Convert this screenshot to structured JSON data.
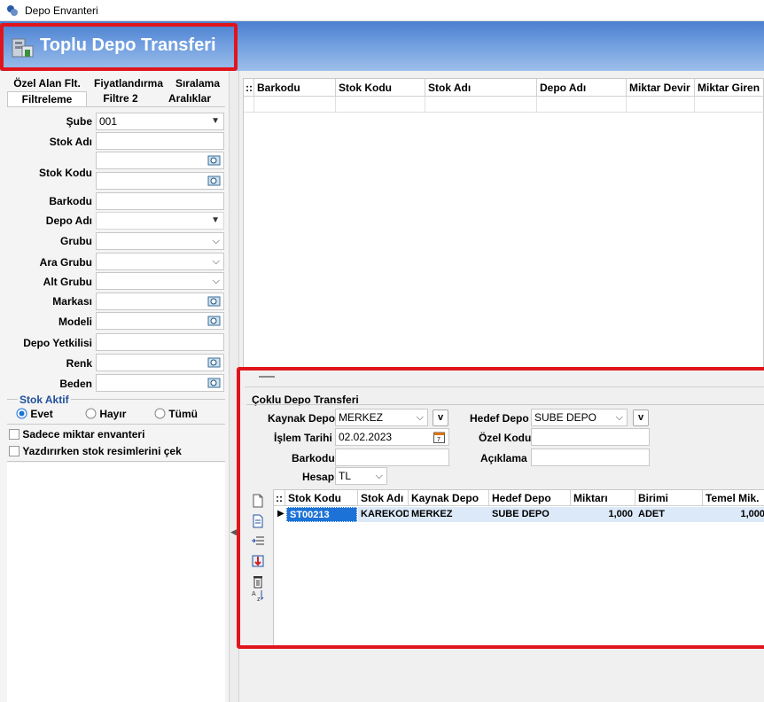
{
  "window": {
    "title": "Depo Envanteri"
  },
  "header": {
    "title": "Toplu Depo Transferi"
  },
  "tabs_row1": [
    "Özel Alan Flt.",
    "Fiyatlandırma",
    "Sıralama"
  ],
  "tabs_row2": [
    "Filtreleme",
    "Filtre 2",
    "Aralıklar"
  ],
  "filters": {
    "sube": {
      "label": "Şube",
      "value": "001"
    },
    "stok_adi": {
      "label": "Stok Adı"
    },
    "stok_kodu": {
      "label": "Stok Kodu"
    },
    "barkodu": {
      "label": "Barkodu"
    },
    "depo_adi": {
      "label": "Depo Adı"
    },
    "grubu": {
      "label": "Grubu"
    },
    "ara_grubu": {
      "label": "Ara Grubu"
    },
    "alt_grubu": {
      "label": "Alt Grubu"
    },
    "markasi": {
      "label": "Markası"
    },
    "modeli": {
      "label": "Modeli"
    },
    "depo_yetkilisi": {
      "label": "Depo Yetkilisi"
    },
    "renk": {
      "label": "Renk"
    },
    "beden": {
      "label": "Beden"
    }
  },
  "stok_aktif": {
    "label": "Stok Aktif",
    "options": [
      "Evet",
      "Hayır",
      "Tümü"
    ],
    "selected": "Evet"
  },
  "checkboxes": [
    "Sadece miktar envanteri",
    "Yazdırırken stok resimlerini çek"
  ],
  "top_grid": {
    "columns": [
      "Barkodu",
      "Stok Kodu",
      "Stok Adı",
      "Depo Adı",
      "Miktar Devir",
      "Miktar Giren"
    ]
  },
  "transfer": {
    "group_title": "Çoklu Depo Transferi",
    "kaynak_depo_label": "Kaynak Depo",
    "kaynak_depo_value": "MERKEZ",
    "hedef_depo_label": "Hedef Depo",
    "hedef_depo_value": "SUBE DEPO",
    "islem_tarihi_label": "İşlem Tarihi",
    "islem_tarihi_value": "02.02.2023",
    "ozel_kodu_label": "Özel Kodu",
    "barkodu_label": "Barkodu",
    "aciklama_label": "Açıklama",
    "hesap_label": "Hesap",
    "hesap_value": "TL",
    "v_label": "v"
  },
  "bottom_grid": {
    "columns": [
      "Stok Kodu",
      "Stok Adı",
      "Kaynak Depo",
      "Hedef Depo",
      "Miktarı",
      "Birimi",
      "Temel Mik."
    ],
    "rows": [
      [
        "ST00213",
        "KAREKOD",
        "MERKEZ",
        "SUBE DEPO",
        "1,000",
        "ADET",
        "1,000"
      ]
    ]
  },
  "colors": {
    "highlight": "#e0151b",
    "header_blue": "#4a7fcf",
    "selected_cell": "#1c72d6"
  }
}
